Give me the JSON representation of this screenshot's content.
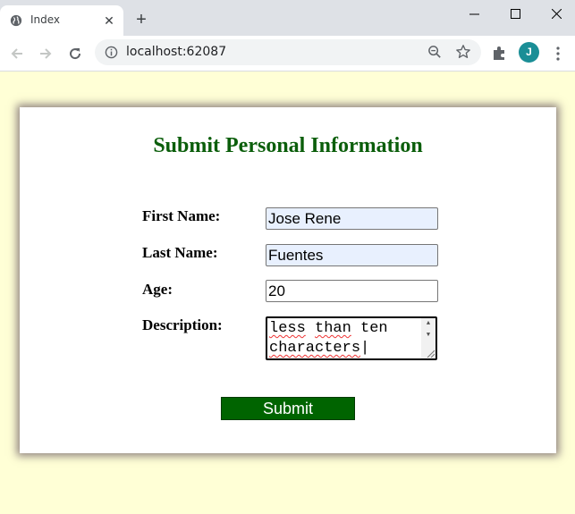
{
  "browser": {
    "tab_title": "Index",
    "url": "localhost:62087",
    "profile_initial": "J",
    "accent_avatar": "#1a8e96"
  },
  "form": {
    "heading": "Submit Personal Information",
    "heading_color": "#0b5e0b",
    "first_name_label": "First Name:",
    "first_name_value": "Jose Rene",
    "last_name_label": "Last Name:",
    "last_name_value": "Fuentes",
    "age_label": "Age:",
    "age_value": "20",
    "description_label": "Description:",
    "description_words": [
      "less",
      "than",
      "ten",
      "characters"
    ],
    "submit_label": "Submit",
    "submit_color": "#006400"
  },
  "colors": {
    "page_background": "#ffffd6",
    "autofill_background": "#e8f0fe"
  },
  "icons": [
    "globe-icon",
    "close-icon",
    "plus-icon",
    "minimize-icon",
    "maximize-icon",
    "window-close-icon",
    "back-icon",
    "forward-icon",
    "reload-icon",
    "info-icon",
    "zoom-icon",
    "star-icon",
    "puzzle-icon",
    "kebab-menu-icon"
  ]
}
